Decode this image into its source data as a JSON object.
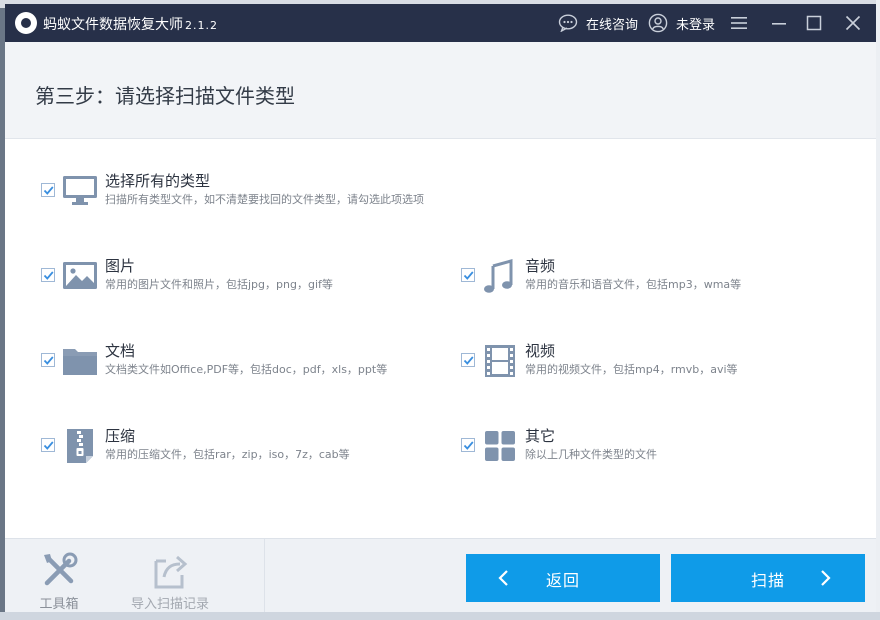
{
  "app": {
    "title": "蚂蚁文件数据恢复大师",
    "version": "2.1.2"
  },
  "titlebar": {
    "consult_label": "在线咨询",
    "login_label": "未登录"
  },
  "header": {
    "step_title": "第三步：请选择扫描文件类型"
  },
  "options": {
    "all": {
      "label": "选择所有的类型",
      "desc": "扫描所有类型文件，如不清楚要找回的文件类型，请勾选此项选项",
      "checked": true,
      "icon": "monitor-icon"
    },
    "image": {
      "label": "图片",
      "desc": "常用的图片文件和照片，包括jpg，png，gif等",
      "checked": true,
      "icon": "image-icon"
    },
    "audio": {
      "label": "音频",
      "desc": "常用的音乐和语音文件，包括mp3，wma等",
      "checked": true,
      "icon": "music-note-icon"
    },
    "doc": {
      "label": "文档",
      "desc": "文档类文件如Office,PDF等，包括doc，pdf，xls，ppt等",
      "checked": true,
      "icon": "folder-icon"
    },
    "video": {
      "label": "视频",
      "desc": "常用的视频文件，包括mp4，rmvb，avi等",
      "checked": true,
      "icon": "film-icon"
    },
    "zip": {
      "label": "压缩",
      "desc": "常用的压缩文件，包括rar，zip，iso，7z，cab等",
      "checked": true,
      "icon": "zip-file-icon"
    },
    "other": {
      "label": "其它",
      "desc": "除以上几种文件类型的文件",
      "checked": true,
      "icon": "grid-icon"
    }
  },
  "footer": {
    "toolbox_label": "工具箱",
    "import_label": "导入扫描记录",
    "back_label": "返回",
    "scan_label": "扫描"
  },
  "colors": {
    "titlebar": "#273049",
    "accent": "#0f9be8",
    "icon": "#7f93ad"
  }
}
